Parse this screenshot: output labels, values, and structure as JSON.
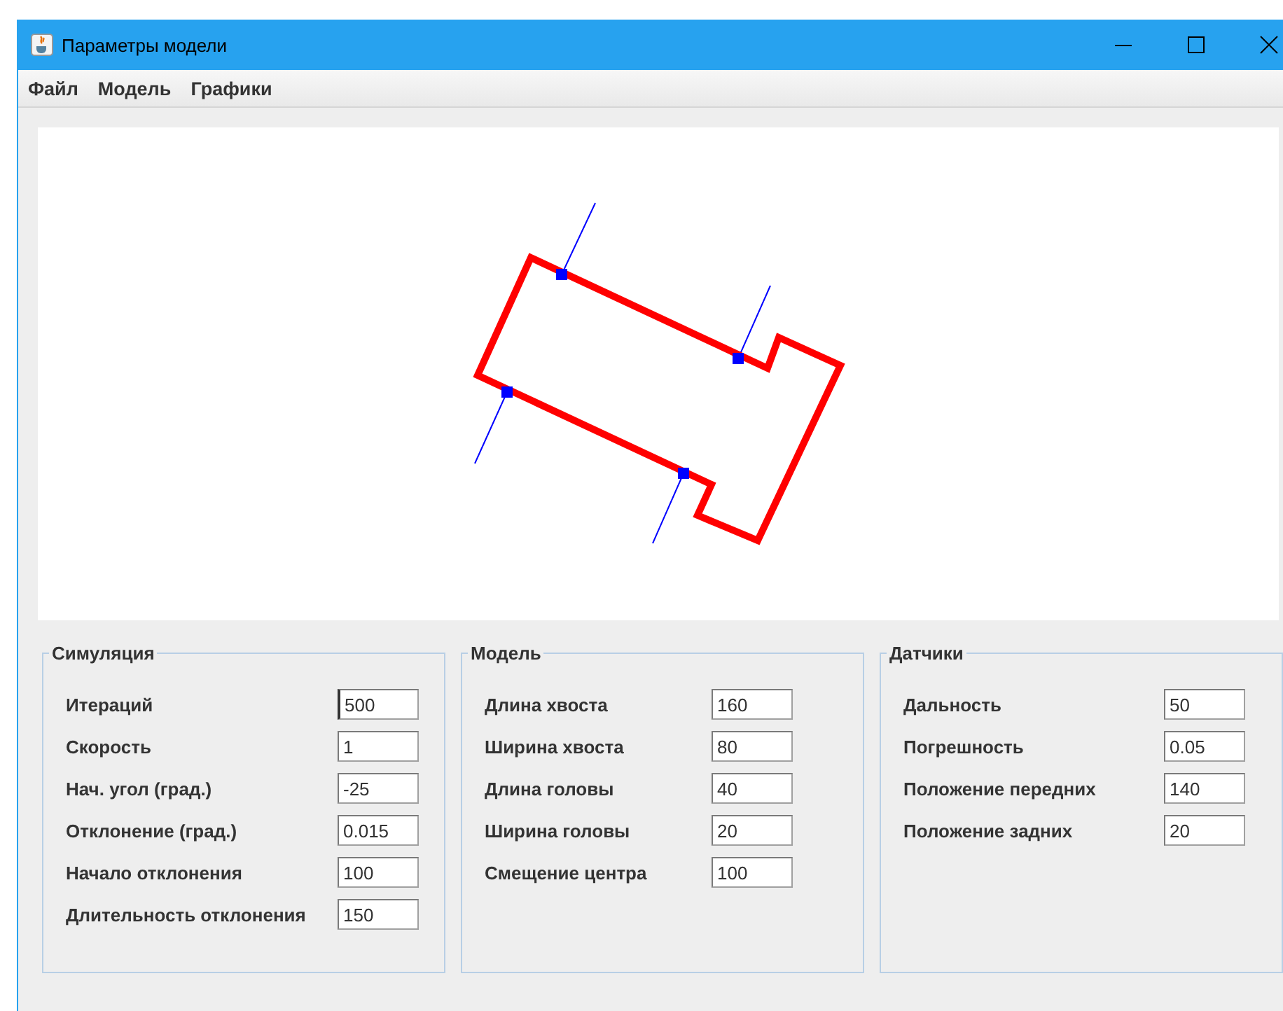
{
  "window": {
    "title": "Параметры модели"
  },
  "menu": [
    "Файл",
    "Модель",
    "Графики"
  ],
  "groups": [
    {
      "title": "Симуляция",
      "fields": [
        {
          "label": "Итераций",
          "value": "500",
          "focused": true
        },
        {
          "label": "Скорость",
          "value": "1",
          "focused": false
        },
        {
          "label": "Нач. угол (град.)",
          "value": "-25",
          "focused": false
        },
        {
          "label": "Отклонение (град.)",
          "value": "0.015",
          "focused": false
        },
        {
          "label": "Начало отклонения",
          "value": "100",
          "focused": false
        },
        {
          "label": "Длительность отклонения",
          "value": "150",
          "focused": false
        }
      ]
    },
    {
      "title": "Модель",
      "fields": [
        {
          "label": "Длина хвоста",
          "value": "160",
          "focused": false
        },
        {
          "label": "Ширина хвоста",
          "value": "80",
          "focused": false
        },
        {
          "label": "Длина головы",
          "value": "40",
          "focused": false
        },
        {
          "label": "Ширина головы",
          "value": "20",
          "focused": false
        },
        {
          "label": "Смещение центра",
          "value": "100",
          "focused": false
        }
      ]
    },
    {
      "title": "Датчики",
      "fields": [
        {
          "label": "Дальность",
          "value": "50",
          "focused": false
        },
        {
          "label": "Погрешность",
          "value": "0.05",
          "focused": false
        },
        {
          "label": "Положение передних",
          "value": "140",
          "focused": false
        },
        {
          "label": "Положение задних",
          "value": "20",
          "focused": false
        }
      ]
    }
  ]
}
